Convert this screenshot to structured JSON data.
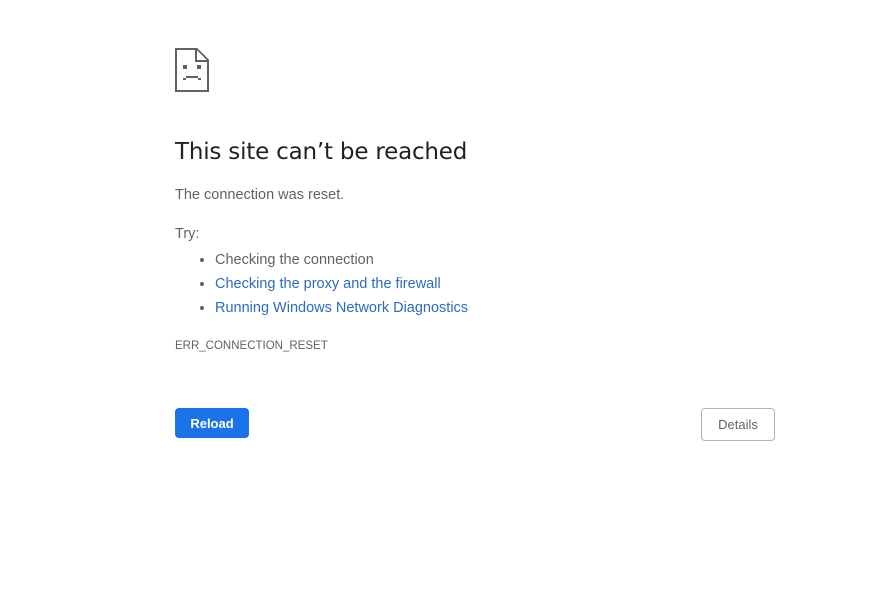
{
  "error_page": {
    "icon": "sad-document-icon",
    "title": "This site can’t be reached",
    "message": "The connection was reset.",
    "try_label": "Try:",
    "suggestions": [
      {
        "text": "Checking the connection",
        "is_link": false
      },
      {
        "text": "Checking the proxy and the firewall",
        "is_link": true
      },
      {
        "text": "Running Windows Network Diagnostics",
        "is_link": true
      }
    ],
    "error_code": "ERR_CONNECTION_RESET",
    "reload_label": "Reload",
    "details_label": "Details"
  },
  "colors": {
    "primary_button": "#1a73e8",
    "link": "#2a6bc4",
    "heading": "#202124",
    "body_text": "#5f6368"
  }
}
